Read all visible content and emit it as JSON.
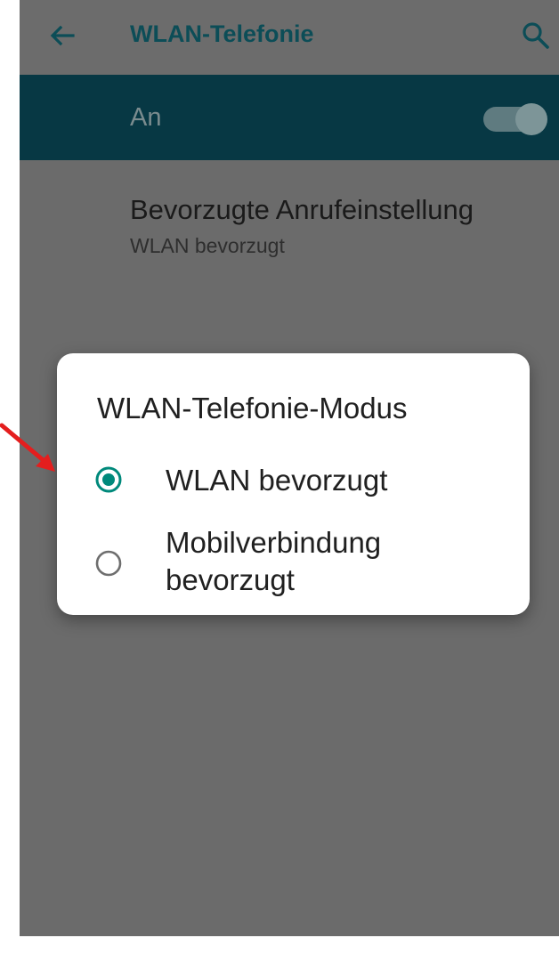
{
  "appbar": {
    "title": "WLAN-Telefonie",
    "back_icon": "arrow-left-icon",
    "search_icon": "search-icon"
  },
  "master_switch": {
    "label": "An",
    "state": "on"
  },
  "preference": {
    "title": "Bevorzugte Anrufeinstellung",
    "summary": "WLAN bevorzugt"
  },
  "dialog": {
    "title": "WLAN-Telefonie-Modus",
    "options": [
      {
        "label": "WLAN bevorzugt",
        "selected": true
      },
      {
        "label": "Mobilverbindung bevorzugt",
        "selected": false
      }
    ]
  },
  "colors": {
    "accent": "#00897b",
    "header_bar": "#073844",
    "scrim": "#6b6b6b",
    "annotation_arrow": "#e41e1e"
  }
}
